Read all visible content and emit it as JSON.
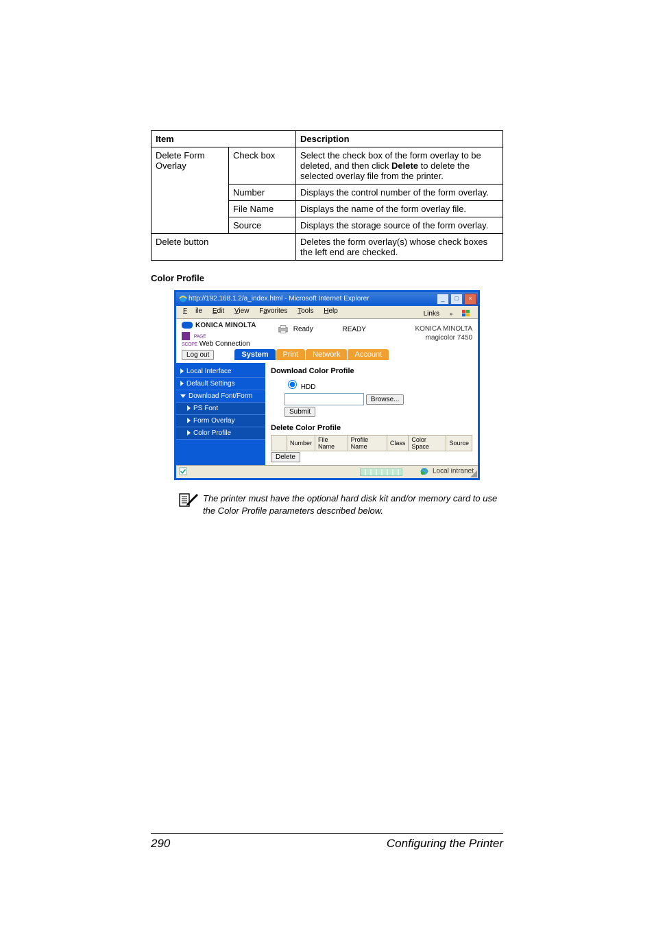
{
  "table": {
    "headers": {
      "item": "Item",
      "desc": "Description"
    },
    "rows": [
      {
        "item": "Delete Form Overlay",
        "sub": "Check box",
        "desc_before": "Select the check box of the form overlay to be deleted, and then click ",
        "desc_bold": "Delete",
        "desc_after": " to delete the selected overlay file from the printer."
      },
      {
        "sub": "Number",
        "desc": "Displays the control number of the form overlay."
      },
      {
        "sub": "File Name",
        "desc": "Displays the name of the form overlay file."
      },
      {
        "sub": "Source",
        "desc": "Displays the storage source of the form overlay."
      },
      {
        "item": "Delete button",
        "desc": "Deletes the form overlay(s) whose check boxes the left end are checked."
      }
    ]
  },
  "section_title": "Color Profile",
  "browser": {
    "title": "http://192.168.1.2/a_index.html - Microsoft Internet Explorer",
    "menu": {
      "file": "File",
      "edit": "Edit",
      "view": "View",
      "favorites": "Favorites",
      "tools": "Tools",
      "help": "Help",
      "links": "Links"
    },
    "brand": "KONICA MINOLTA",
    "pagescope": "PageScope Web Connection",
    "status_label": "Ready",
    "status_text": "READY",
    "device_brand": "KONICA MINOLTA",
    "device_model": "magicolor 7450",
    "logout": "Log out",
    "tabs": {
      "system": "System",
      "print": "Print",
      "network": "Network",
      "account": "Account"
    },
    "nav": {
      "local_interface": "Local Interface",
      "default_settings": "Default Settings",
      "download_font_form": "Download Font/Form",
      "ps_font": "PS Font",
      "form_overlay": "Form Overlay",
      "color_profile": "Color Profile"
    },
    "main": {
      "dl_heading": "Download Color Profile",
      "hdd": "HDD",
      "browse": "Browse...",
      "submit": "Submit",
      "del_heading": "Delete Color Profile",
      "cols": {
        "number": "Number",
        "file_name": "File Name",
        "profile_name": "Profile Name",
        "class": "Class",
        "color_space": "Color Space",
        "source": "Source"
      },
      "delete": "Delete"
    },
    "zone": "Local intranet"
  },
  "note_text": "The printer must have the optional hard disk kit and/or memory card to use the Color Profile parameters described below.",
  "footer": {
    "page": "290",
    "title": "Configuring the Printer"
  }
}
